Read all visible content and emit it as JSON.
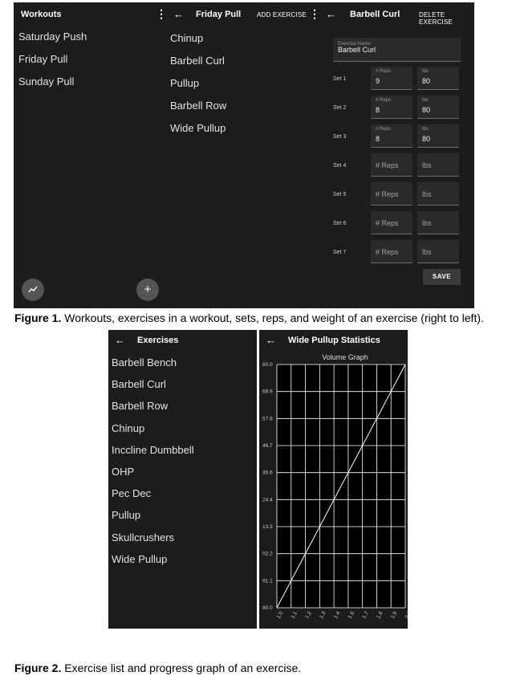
{
  "workouts_screen": {
    "title": "Workouts",
    "items": [
      "Saturday Push",
      "Friday Pull",
      "Sunday Pull"
    ],
    "fab_icon": "trending-up-icon"
  },
  "workout_screen": {
    "title": "Friday Pull",
    "action": "ADD EXERCISE",
    "items": [
      "Chinup",
      "Barbell Curl",
      "Pullup",
      "Barbell Row",
      "Wide Pullup"
    ],
    "fab_label": "+"
  },
  "exercise_screen": {
    "title": "Barbell Curl",
    "action": "DELETE EXERCISE",
    "name_field": {
      "label": "Exercise Name",
      "value": "Barbell Curl"
    },
    "reps_label": "# Reps",
    "lbs_label": "lbs",
    "reps_placeholder": "# Reps",
    "lbs_placeholder": "lbs",
    "sets": [
      {
        "label": "Set 1",
        "reps": "9",
        "lbs": "80"
      },
      {
        "label": "Set 2",
        "reps": "8",
        "lbs": "80"
      },
      {
        "label": "Set 3",
        "reps": "8",
        "lbs": "80"
      },
      {
        "label": "Set 4",
        "reps": "",
        "lbs": ""
      },
      {
        "label": "Set 5",
        "reps": "",
        "lbs": ""
      },
      {
        "label": "Set 6",
        "reps": "",
        "lbs": ""
      },
      {
        "label": "Set 7",
        "reps": "",
        "lbs": ""
      }
    ],
    "save_label": "SAVE"
  },
  "figure1_caption": {
    "label": "Figure 1.",
    "text": " Workouts, exercises in a workout, sets, reps, and weight of an exercise (right to left)."
  },
  "exercises_screen": {
    "title": "Exercises",
    "items": [
      "Barbell Bench",
      "Barbell Curl",
      "Barbell Row",
      "Chinup",
      "Inccline Dumbbell",
      "OHP",
      "Pec Dec",
      "Pullup",
      "Skullcrushers",
      "Wide Pullup"
    ]
  },
  "stats_screen": {
    "title": "Wide Pullup Statistics"
  },
  "chart_data": {
    "type": "line",
    "title": "Volume Graph",
    "x_ticks": [
      "1.0",
      "1.1",
      "1.2",
      "1.3",
      "1.4",
      "1.6",
      "1.7",
      "1.8",
      "1.9",
      "2.0"
    ],
    "y_ticks": [
      "80.0",
      "68.9",
      "57.8",
      "46.7",
      "35.6",
      "24.4",
      "13.3",
      "02.2",
      "91.1",
      "80.0"
    ],
    "series": [
      {
        "values": [
          {
            "x": 1.0,
            "y": 0.0
          },
          {
            "x": 2.0,
            "y": 1.0
          }
        ]
      }
    ],
    "grid": true,
    "colors": {
      "line": "#ffffff",
      "grid": "#ffffff",
      "background": "#000000"
    }
  },
  "figure2_caption": {
    "label": "Figure 2.",
    "text": " Exercise list and progress graph of an exercise."
  }
}
